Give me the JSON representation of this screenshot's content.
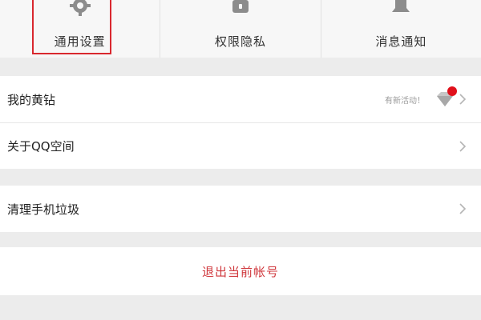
{
  "tabs": [
    {
      "label": "通用设置",
      "icon": "gear-icon",
      "active": true
    },
    {
      "label": "权限隐私",
      "icon": "lock-icon",
      "active": false
    },
    {
      "label": "消息通知",
      "icon": "bell-icon",
      "active": false
    }
  ],
  "groups": {
    "first": {
      "yellow_diamond": {
        "label": "我的黄钻",
        "hint": "有新活动！",
        "icon": "diamond-icon"
      },
      "about": {
        "label": "关于QQ空间"
      }
    },
    "second": {
      "clean": {
        "label": "清理手机垃圾"
      }
    },
    "third": {
      "logout": {
        "label": "退出当前帐号"
      }
    }
  },
  "colors": {
    "accent_red": "#d9272e",
    "logout_text": "#d0393e",
    "background": "#ececec",
    "badge_dot": "#e0101b"
  }
}
